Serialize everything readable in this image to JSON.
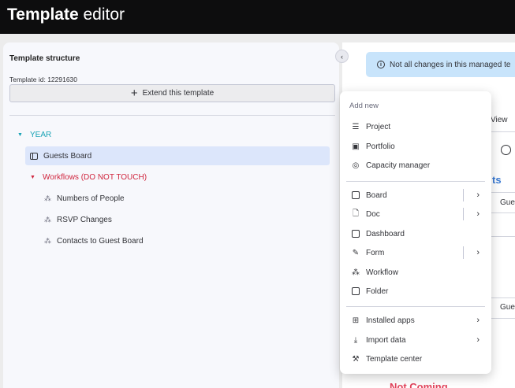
{
  "topbar": {
    "title_bold": "Template",
    "title_light": "editor"
  },
  "left": {
    "heading": "Template structure",
    "template_id": "Template id: 12291630",
    "extend_label": "Extend this template",
    "tree": {
      "year": "YEAR",
      "guests_board": "Guests Board",
      "workflows": "Workflows (DO NOT TOUCH)",
      "workflow_items": [
        "Numbers of People",
        "RSVP Changes",
        "Contacts to Guest Board"
      ]
    }
  },
  "right": {
    "banner": "Not all changes in this managed te",
    "view": "View",
    "ts": "ts",
    "gue": "Gue",
    "not_coming": "Not Coming"
  },
  "menu": {
    "header": "Add new",
    "group1": [
      {
        "label": "Project",
        "icon": "project-icon"
      },
      {
        "label": "Portfolio",
        "icon": "portfolio-icon"
      },
      {
        "label": "Capacity manager",
        "icon": "capacity-icon"
      }
    ],
    "group2": [
      {
        "label": "Board",
        "icon": "board-icon",
        "submenu": true,
        "split": true
      },
      {
        "label": "Doc",
        "icon": "doc-icon",
        "submenu": true,
        "split": true
      },
      {
        "label": "Dashboard",
        "icon": "dashboard-icon",
        "submenu": false
      },
      {
        "label": "Form",
        "icon": "form-icon",
        "submenu": true,
        "split": true
      },
      {
        "label": "Workflow",
        "icon": "workflow-icon",
        "submenu": false
      },
      {
        "label": "Folder",
        "icon": "folder-icon",
        "submenu": false
      }
    ],
    "group3": [
      {
        "label": "Installed apps",
        "icon": "apps-icon",
        "submenu": true
      },
      {
        "label": "Import data",
        "icon": "import-icon",
        "submenu": true
      },
      {
        "label": "Template center",
        "icon": "template-center-icon",
        "submenu": false
      }
    ]
  },
  "colors": {
    "year": "#1aa3b6",
    "workflows": "#d0263e",
    "selected": "#dce6fb",
    "banner": "#c8e4fb"
  }
}
